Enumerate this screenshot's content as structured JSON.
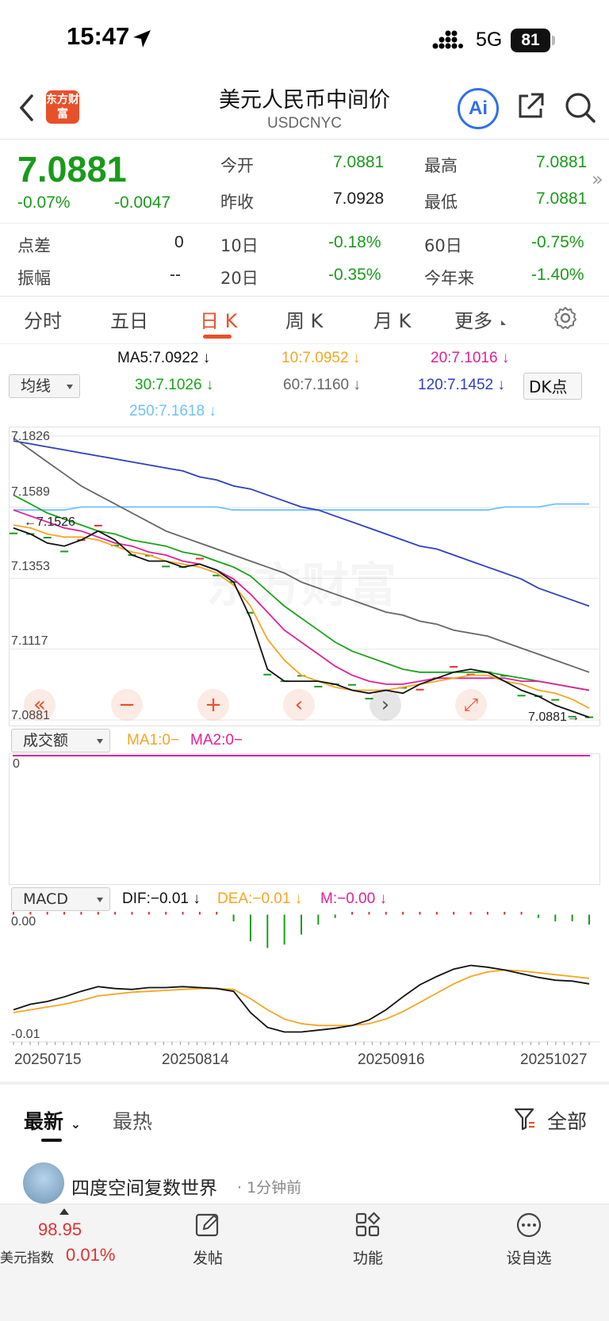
{
  "status_bar": {
    "time": "15:47",
    "carrier": "5G",
    "battery": "81"
  },
  "header": {
    "logo_text": "东方财富",
    "title": "美元人民币中间价",
    "code": "USDCNYC",
    "ai_label": "Ai"
  },
  "quote": {
    "price": "7.0881",
    "change_pct": "-0.07%",
    "change": "-0.0047",
    "open_label": "今开",
    "open": "7.0881",
    "high_label": "最高",
    "high": "7.0881",
    "prev_close_label": "昨收",
    "prev_close": "7.0928",
    "low_label": "最低",
    "low": "7.0881",
    "spread_label": "点差",
    "spread": "0",
    "amplitude_label": "振幅",
    "amplitude": "--",
    "d10_label": "10日",
    "d10": "-0.18%",
    "d20_label": "20日",
    "d20": "-0.35%",
    "d60_label": "60日",
    "d60": "-0.75%",
    "ytd_label": "今年来",
    "ytd": "-1.40%"
  },
  "tabs": [
    "分时",
    "五日",
    "日 K",
    "周 K",
    "月 K",
    "更多"
  ],
  "active_tab": "日 K",
  "ma_legend": {
    "selector": "均线",
    "ma5": "MA5:7.0922",
    "ma10": "10:7.0952",
    "ma20": "20:7.1016",
    "ma30": "30:7.1026",
    "ma60": "60:7.1160",
    "ma120": "120:7.1452",
    "ma250": "250:7.1618",
    "dk_button": "DK点",
    "down_arrow": "↓"
  },
  "colors": {
    "accent": "#e8502a",
    "up": "#e03131",
    "down": "#1a9a1a",
    "ma5": "#111111",
    "ma10": "#f5a623",
    "ma20": "#e0209a",
    "ma30": "#1aa31a",
    "ma60": "#666666",
    "ma120": "#2f3fbf",
    "ma250": "#6ec1ff"
  },
  "chart_data": [
    {
      "type": "line",
      "title": "日K",
      "ylim": [
        7.0881,
        7.1826
      ],
      "y_ticks": [
        "7.1826",
        "7.1589",
        "7.1353",
        "7.1117",
        "7.0881"
      ],
      "max_marker": "←7.1526",
      "last_marker": "7.0881→",
      "series": [
        {
          "name": "MA5",
          "color": "#111111",
          "values": [
            7.152,
            7.15,
            7.147,
            7.146,
            7.148,
            7.151,
            7.148,
            7.143,
            7.141,
            7.141,
            7.139,
            7.14,
            7.138,
            7.134,
            7.122,
            7.105,
            7.101,
            7.101,
            7.101,
            7.1,
            7.098,
            7.097,
            7.098,
            7.097,
            7.1,
            7.102,
            7.104,
            7.105,
            7.104,
            7.101,
            7.098,
            7.096,
            7.093,
            7.091,
            7.089
          ]
        },
        {
          "name": "MA10",
          "color": "#f5a623",
          "values": [
            7.153,
            7.152,
            7.15,
            7.149,
            7.149,
            7.148,
            7.146,
            7.144,
            7.143,
            7.141,
            7.14,
            7.139,
            7.137,
            7.133,
            7.126,
            7.115,
            7.108,
            7.103,
            7.101,
            7.099,
            7.098,
            7.098,
            7.098,
            7.099,
            7.1,
            7.101,
            7.102,
            7.103,
            7.103,
            7.101,
            7.1,
            7.098,
            7.097,
            7.095,
            7.092
          ]
        },
        {
          "name": "MA20",
          "color": "#e0209a",
          "values": [
            7.158,
            7.156,
            7.154,
            7.152,
            7.151,
            7.149,
            7.147,
            7.146,
            7.144,
            7.143,
            7.141,
            7.14,
            7.138,
            7.135,
            7.13,
            7.124,
            7.118,
            7.114,
            7.11,
            7.106,
            7.103,
            7.101,
            7.1,
            7.1,
            7.101,
            7.102,
            7.102,
            7.102,
            7.102,
            7.102,
            7.101,
            7.101,
            7.1,
            7.099,
            7.098
          ]
        },
        {
          "name": "MA30",
          "color": "#1aa31a",
          "values": [
            7.163,
            7.16,
            7.157,
            7.155,
            7.153,
            7.151,
            7.15,
            7.148,
            7.147,
            7.146,
            7.144,
            7.143,
            7.141,
            7.139,
            7.136,
            7.131,
            7.126,
            7.122,
            7.118,
            7.114,
            7.111,
            7.109,
            7.107,
            7.105,
            7.104,
            7.104,
            7.104,
            7.104,
            7.104,
            7.103,
            7.102,
            7.101,
            7.1,
            7.099,
            7.098
          ]
        },
        {
          "name": "MA60",
          "color": "#666666",
          "values": [
            7.182,
            7.178,
            7.174,
            7.17,
            7.166,
            7.163,
            7.16,
            7.157,
            7.154,
            7.151,
            7.149,
            7.147,
            7.145,
            7.143,
            7.141,
            7.139,
            7.137,
            7.134,
            7.132,
            7.13,
            7.128,
            7.126,
            7.124,
            7.123,
            7.121,
            7.12,
            7.118,
            7.117,
            7.116,
            7.114,
            7.112,
            7.11,
            7.108,
            7.106,
            7.104
          ]
        },
        {
          "name": "MA120",
          "color": "#2f3fbf",
          "values": [
            7.181,
            7.18,
            7.179,
            7.178,
            7.177,
            7.176,
            7.175,
            7.174,
            7.173,
            7.172,
            7.171,
            7.169,
            7.168,
            7.166,
            7.165,
            7.163,
            7.161,
            7.159,
            7.158,
            7.156,
            7.154,
            7.152,
            7.15,
            7.148,
            7.146,
            7.145,
            7.143,
            7.141,
            7.139,
            7.137,
            7.135,
            7.132,
            7.13,
            7.128,
            7.126
          ]
        },
        {
          "name": "MA250",
          "color": "#6ec1ff",
          "values": [
            7.158,
            7.158,
            7.158,
            7.158,
            7.159,
            7.159,
            7.159,
            7.159,
            7.159,
            7.159,
            7.159,
            7.159,
            7.159,
            7.158,
            7.158,
            7.158,
            7.158,
            7.158,
            7.158,
            7.158,
            7.158,
            7.158,
            7.158,
            7.158,
            7.158,
            7.158,
            7.158,
            7.158,
            7.158,
            7.159,
            7.159,
            7.159,
            7.16,
            7.16,
            7.16
          ]
        }
      ]
    },
    {
      "type": "bar",
      "title": "MACD",
      "ylim": [
        -0.01,
        0.0
      ],
      "y_ticks": [
        "0.00",
        "-0.01"
      ],
      "categories": [
        "20250715",
        "20250814",
        "20250916",
        "20251027"
      ],
      "series": [
        {
          "name": "M",
          "values": [
            0.0002,
            0.0003,
            0.0004,
            0.0003,
            0.0005,
            0.0006,
            0.0004,
            0.0002,
            0.0001,
            0.0002,
            0.0001,
            0.0001,
            0.0001,
            -0.0002,
            -0.0008,
            -0.001,
            -0.0009,
            -0.0006,
            -0.0003,
            -0.0001,
            0.0001,
            0.0002,
            0.0004,
            0.0007,
            0.001,
            0.0012,
            0.0013,
            0.0012,
            0.0009,
            0.0005,
            0.0002,
            -0.0001,
            -0.0002,
            -0.0002,
            -0.0003
          ]
        },
        {
          "name": "DIF",
          "values": [
            -0.0072,
            -0.0066,
            -0.0063,
            -0.0058,
            -0.0052,
            -0.0047,
            -0.0049,
            -0.005,
            -0.0048,
            -0.0048,
            -0.0047,
            -0.0048,
            -0.0049,
            -0.0052,
            -0.0075,
            -0.0091,
            -0.0096,
            -0.0096,
            -0.0094,
            -0.0092,
            -0.0089,
            -0.0083,
            -0.0072,
            -0.0058,
            -0.0045,
            -0.0036,
            -0.0028,
            -0.0024,
            -0.0026,
            -0.0029,
            -0.0033,
            -0.0037,
            -0.004,
            -0.0041,
            -0.0044
          ]
        },
        {
          "name": "DEA",
          "values": [
            -0.0075,
            -0.0072,
            -0.0069,
            -0.0066,
            -0.0062,
            -0.0057,
            -0.0055,
            -0.0053,
            -0.0052,
            -0.0051,
            -0.005,
            -0.0049,
            -0.0049,
            -0.005,
            -0.006,
            -0.0072,
            -0.0082,
            -0.0087,
            -0.0089,
            -0.0089,
            -0.0089,
            -0.0087,
            -0.0082,
            -0.0074,
            -0.0064,
            -0.0054,
            -0.0044,
            -0.0036,
            -0.0031,
            -0.0029,
            -0.003,
            -0.0032,
            -0.0034,
            -0.0036,
            -0.0038
          ]
        }
      ]
    }
  ],
  "volume": {
    "selector": "成交额",
    "ma1": "MA1:0−",
    "ma2": "MA2:0−",
    "zero": "0"
  },
  "macd_legend": {
    "selector": "MACD",
    "dif": "DIF:−0.01",
    "dea": "DEA:−0.01",
    "m": "M:−0.00",
    "arrow": "↓"
  },
  "x_axis": [
    "20250715",
    "20250814",
    "20250916",
    "20251027"
  ],
  "feed": {
    "tab_latest": "最新",
    "tab_hot": "最热",
    "filter": "全部",
    "post_author": "四度空间复数世界",
    "post_time": "· 1分钟前"
  },
  "bottom_bar": {
    "index_value": "98.95",
    "index_name": "美元指数",
    "index_change": "0.01%",
    "post": "发帖",
    "functions": "功能",
    "watchlist": "设自选"
  }
}
